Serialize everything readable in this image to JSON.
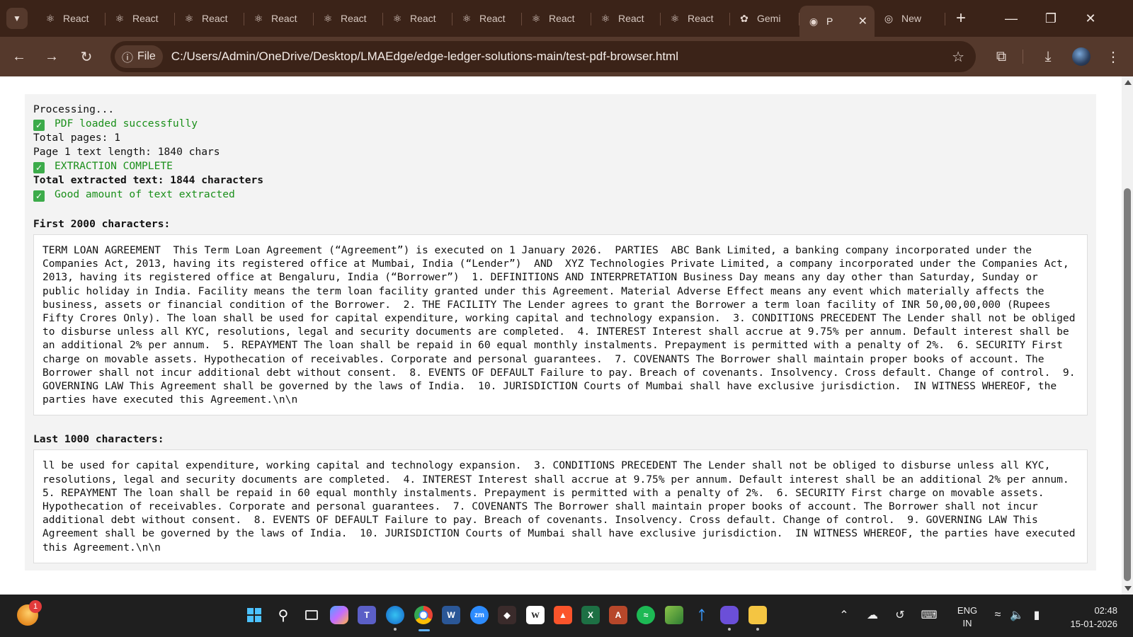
{
  "browser": {
    "tabs": [
      {
        "title": "React",
        "icon": "react-icon"
      },
      {
        "title": "React",
        "icon": "react-icon"
      },
      {
        "title": "React",
        "icon": "react-icon"
      },
      {
        "title": "React",
        "icon": "react-icon"
      },
      {
        "title": "React",
        "icon": "react-icon"
      },
      {
        "title": "React",
        "icon": "react-icon"
      },
      {
        "title": "React",
        "icon": "react-icon"
      },
      {
        "title": "React",
        "icon": "react-icon"
      },
      {
        "title": "React",
        "icon": "react-icon"
      },
      {
        "title": "React",
        "icon": "react-icon"
      },
      {
        "title": "Gemi",
        "icon": "gemini-icon"
      },
      {
        "title": "P",
        "icon": "globe-icon",
        "active": true
      },
      {
        "title": "New",
        "icon": "chrome-icon"
      }
    ],
    "site_chip": "File",
    "url": "C:/Users/Admin/OneDrive/Desktop/LMAEdge/edge-ledger-solutions-main/test-pdf-browser.html",
    "colors": {
      "frame": "#3b2318",
      "toolbar": "#55392c",
      "success": "#1a8f1a"
    }
  },
  "log": {
    "processing": "Processing...",
    "pdf_loaded": "PDF loaded successfully",
    "total_pages": "Total pages: 1",
    "page1_length": "Page 1 text length: 1840 chars",
    "extraction_complete": "EXTRACTION COMPLETE",
    "total_extracted": "Total extracted text: 1844 characters",
    "good_amount": "Good amount of text extracted"
  },
  "first_section": {
    "label": "First 2000 characters:",
    "text": "TERM LOAN AGREEMENT  This Term Loan Agreement (“Agreement”) is executed on 1 January 2026.  PARTIES  ABC Bank Limited, a banking company incorporated under the Companies Act, 2013, having its registered office at Mumbai, India (“Lender”)  AND  XYZ Technologies Private Limited, a company incorporated under the Companies Act, 2013, having its registered office at Bengaluru, India (“Borrower”)  1. DEFINITIONS AND INTERPRETATION Business Day means any day other than Saturday, Sunday or public holiday in India. Facility means the term loan facility granted under this Agreement. Material Adverse Effect means any event which materially affects the business, assets or financial condition of the Borrower.  2. THE FACILITY The Lender agrees to grant the Borrower a term loan facility of INR 50,00,00,000 (Rupees Fifty Crores Only). The loan shall be used for capital expenditure, working capital and technology expansion.  3. CONDITIONS PRECEDENT The Lender shall not be obliged to disburse unless all KYC, resolutions, legal and security documents are completed.  4. INTEREST Interest shall accrue at 9.75% per annum. Default interest shall be an additional 2% per annum.  5. REPAYMENT The loan shall be repaid in 60 equal monthly instalments. Prepayment is permitted with a penalty of 2%.  6. SECURITY First charge on movable assets. Hypothecation of receivables. Corporate and personal guarantees.  7. COVENANTS The Borrower shall maintain proper books of account. The Borrower shall not incur additional debt without consent.  8. EVENTS OF DEFAULT Failure to pay. Breach of covenants. Insolvency. Cross default. Change of control.  9. GOVERNING LAW This Agreement shall be governed by the laws of India.  10. JURISDICTION Courts of Mumbai shall have exclusive jurisdiction.  IN WITNESS WHEREOF, the parties have executed this Agreement.\\n\\n"
  },
  "last_section": {
    "label": "Last 1000 characters:",
    "text": "ll be used for capital expenditure, working capital and technology expansion.  3. CONDITIONS PRECEDENT The Lender shall not be obliged to disburse unless all KYC, resolutions, legal and security documents are completed.  4. INTEREST Interest shall accrue at 9.75% per annum. Default interest shall be an additional 2% per annum.  5. REPAYMENT The loan shall be repaid in 60 equal monthly instalments. Prepayment is permitted with a penalty of 2%.  6. SECURITY First charge on movable assets. Hypothecation of receivables. Corporate and personal guarantees.  7. COVENANTS The Borrower shall maintain proper books of account. The Borrower shall not incur additional debt without consent.  8. EVENTS OF DEFAULT Failure to pay. Breach of covenants. Insolvency. Cross default. Change of control.  9. GOVERNING LAW This Agreement shall be governed by the laws of India.  10. JURISDICTION Courts of Mumbai shall have exclusive jurisdiction.  IN WITNESS WHEREOF, the parties have executed this Agreement.\\n\\n"
  },
  "taskbar": {
    "weather_badge": "1",
    "language": "ENG",
    "region": "IN",
    "time": "02:48",
    "date": "15-01-2026"
  }
}
